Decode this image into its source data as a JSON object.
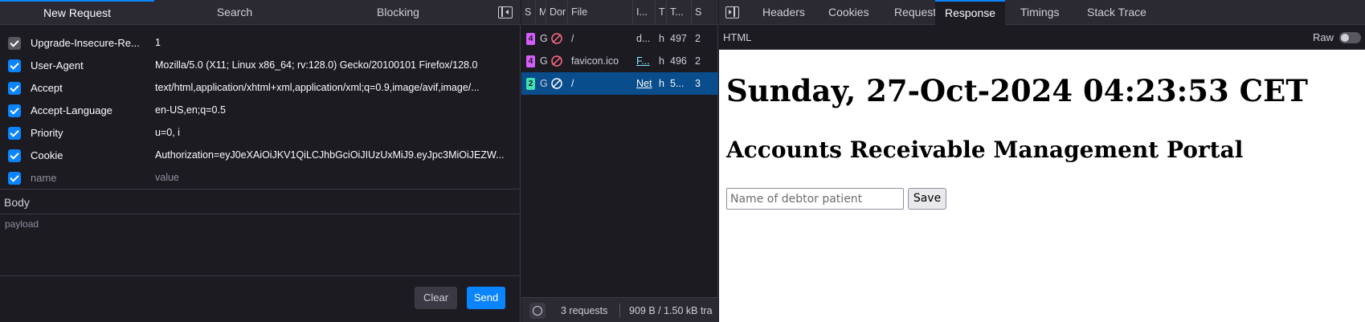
{
  "left": {
    "tabs": [
      "New Request",
      "Search",
      "Blocking"
    ],
    "headers": [
      {
        "name": "Upgrade-Insecure-Re...",
        "value": "1",
        "checked": true
      },
      {
        "name": "User-Agent",
        "value": "Mozilla/5.0 (X11; Linux x86_64; rv:128.0) Gecko/20100101 Firefox/128.0",
        "checked": true
      },
      {
        "name": "Accept",
        "value": "text/html,application/xhtml+xml,application/xml;q=0.9,image/avif,image/...",
        "checked": true
      },
      {
        "name": "Accept-Language",
        "value": "en-US,en;q=0.5",
        "checked": true
      },
      {
        "name": "Priority",
        "value": "u=0, i",
        "checked": true
      },
      {
        "name": "Cookie",
        "value": "Authorization=eyJ0eXAiOiJKV1QiLCJhbGciOiJIUzUxMiJ9.eyJpc3MiOiJEZW...",
        "checked": true
      }
    ],
    "new_header": {
      "name_placeholder": "name",
      "value_placeholder": "value"
    },
    "body_label": "Body",
    "payload_placeholder": "payload",
    "clear_label": "Clear",
    "send_label": "Send"
  },
  "middle": {
    "columns": [
      "S",
      "M",
      "Dor",
      "File",
      "I...",
      "T",
      "T...",
      "S"
    ],
    "rows": [
      {
        "status": "4",
        "method": "G",
        "file": "/",
        "initiator": "d...",
        "type": "h",
        "transferred": "497",
        "size": "2"
      },
      {
        "status": "4",
        "method": "G",
        "file": "favicon.ico",
        "initiator": "F...",
        "type": "h",
        "transferred": "496",
        "size": "2"
      },
      {
        "status": "2",
        "method": "G",
        "file": "/",
        "initiator": "Net",
        "type": "h",
        "transferred": "5...",
        "size": "3"
      }
    ],
    "footer": {
      "requests": "3 requests",
      "transfer": "909 B / 1.50 kB tra"
    }
  },
  "right": {
    "tabs": [
      "Headers",
      "Cookies",
      "Request",
      "Response",
      "Timings",
      "Stack Trace"
    ],
    "active_tab": "Response",
    "format_label": "HTML",
    "raw_label": "Raw",
    "response": {
      "heading": "Sunday, 27-Oct-2024 04:23:53 CET",
      "subheading": "Accounts Receivable Management Portal",
      "input_placeholder": "Name of debtor patient",
      "save_label": "Save"
    }
  },
  "colors": {
    "accent": "#0a84ff",
    "status_4xx": "#d45dfa",
    "status_2xx": "#3fe1b0"
  }
}
